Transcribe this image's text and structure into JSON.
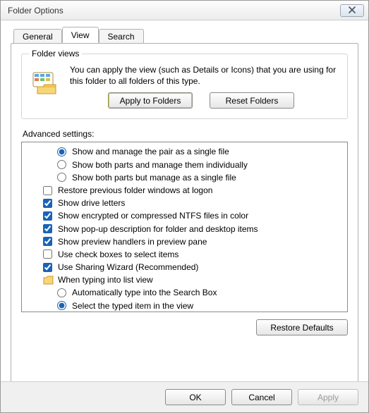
{
  "title": "Folder Options",
  "tabs": {
    "general": "General",
    "view": "View",
    "search": "Search"
  },
  "folderViews": {
    "legend": "Folder views",
    "text": "You can apply the view (such as Details or Icons) that you are using for this folder to all folders of this type.",
    "applyBtn": "Apply to Folders",
    "resetBtn": "Reset Folders"
  },
  "advancedLabel": "Advanced settings:",
  "advanced": [
    {
      "kind": "radio",
      "indent": 2,
      "checked": true,
      "label": "Show and manage the pair as a single file"
    },
    {
      "kind": "radio",
      "indent": 2,
      "checked": false,
      "label": "Show both parts and manage them individually"
    },
    {
      "kind": "radio",
      "indent": 2,
      "checked": false,
      "label": "Show both parts but manage as a single file"
    },
    {
      "kind": "checkbox",
      "indent": 1,
      "checked": false,
      "label": "Restore previous folder windows at logon"
    },
    {
      "kind": "checkbox",
      "indent": 1,
      "checked": true,
      "label": "Show drive letters"
    },
    {
      "kind": "checkbox",
      "indent": 1,
      "checked": true,
      "label": "Show encrypted or compressed NTFS files in color"
    },
    {
      "kind": "checkbox",
      "indent": 1,
      "checked": true,
      "label": "Show pop-up description for folder and desktop items"
    },
    {
      "kind": "checkbox",
      "indent": 1,
      "checked": true,
      "label": "Show preview handlers in preview pane"
    },
    {
      "kind": "checkbox",
      "indent": 1,
      "checked": false,
      "label": "Use check boxes to select items"
    },
    {
      "kind": "checkbox",
      "indent": 1,
      "checked": true,
      "label": "Use Sharing Wizard (Recommended)"
    },
    {
      "kind": "folder",
      "indent": 1,
      "label": "When typing into list view"
    },
    {
      "kind": "radio",
      "indent": 2,
      "checked": false,
      "label": "Automatically type into the Search Box"
    },
    {
      "kind": "radio",
      "indent": 2,
      "checked": true,
      "label": "Select the typed item in the view"
    }
  ],
  "restoreDefaults": "Restore Defaults",
  "buttons": {
    "ok": "OK",
    "cancel": "Cancel",
    "apply": "Apply"
  }
}
